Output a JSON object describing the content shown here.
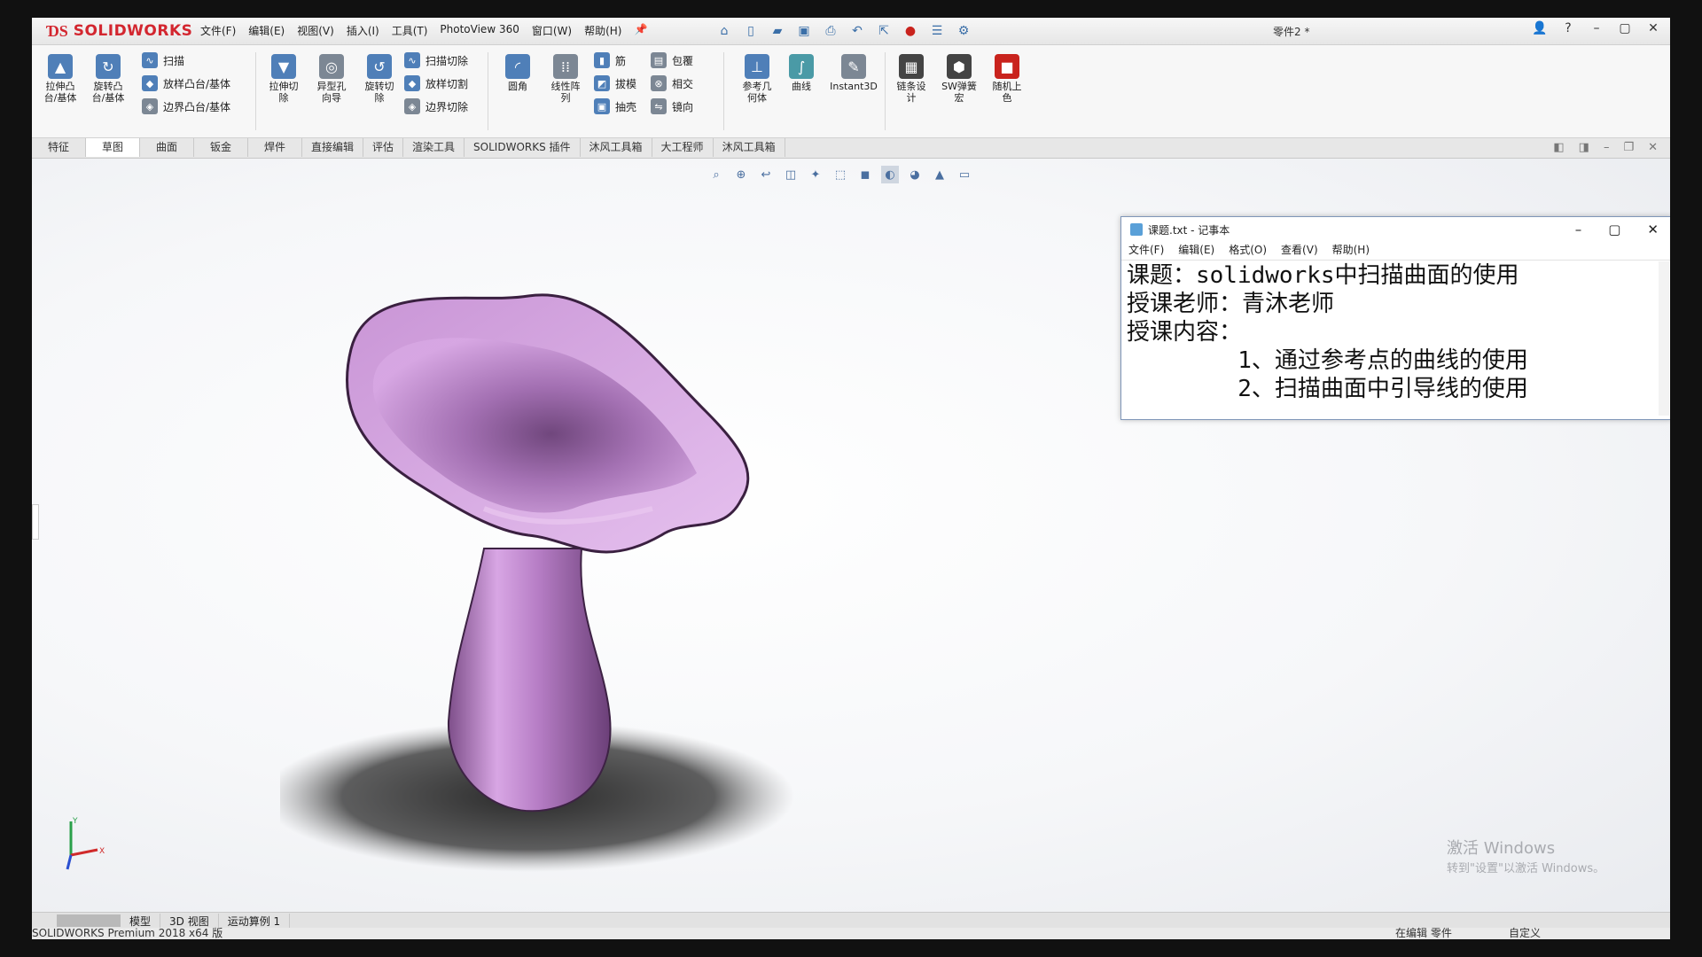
{
  "app": {
    "logo_text": "SOLIDWORKS",
    "doc_title": "零件2 *"
  },
  "menu": [
    "文件(F)",
    "编辑(E)",
    "视图(V)",
    "插入(I)",
    "工具(T)",
    "PhotoView 360",
    "窗口(W)",
    "帮助(H)"
  ],
  "ribbon": {
    "extrude_boss": "拉伸凸\n台/基体",
    "revolve_boss": "旋转凸\n台/基体",
    "sweep": "扫描",
    "loft_boss": "放样凸台/基体",
    "boundary_boss": "边界凸台/基体",
    "extrude_cut": "拉伸切\n除",
    "hole_wizard": "异型孔\n向导",
    "revolve_cut": "旋转切\n除",
    "swept_cut": "扫描切除",
    "lofted_cut": "放样切割",
    "boundary_cut": "边界切除",
    "fillet": "圆角",
    "linear_pattern": "线性阵\n列",
    "rib": "筋",
    "draft": "拔模",
    "shell": "抽壳",
    "wrap": "包覆",
    "intersect": "相交",
    "mirror": "镜向",
    "ref_geometry": "参考几\n何体",
    "curves": "曲线",
    "instant3d": "Instant3D",
    "chain_design": "链条设\n计",
    "sw_macro": "SW弹簧\n宏",
    "random_color": "随机上\n色"
  },
  "tabs": [
    "特征",
    "草图",
    "曲面",
    "钣金",
    "焊件",
    "直接编辑",
    "评估",
    "渲染工具",
    "SOLIDWORKS 插件",
    "沐风工具箱",
    "大工程师",
    "沐风工具箱"
  ],
  "active_tab": 0,
  "notepad": {
    "title": "课题.txt - 记事本",
    "menu": [
      "文件(F)",
      "编辑(E)",
      "格式(O)",
      "查看(V)",
      "帮助(H)"
    ],
    "lines": [
      "课题：solidworks中扫描曲面的使用",
      "授课老师：青沐老师",
      "授课内容：",
      "        1、通过参考点的曲线的使用",
      "        2、扫描曲面中引导线的使用"
    ]
  },
  "watermark": {
    "line1": "激活 Windows",
    "line2": "转到\"设置\"以激活 Windows。"
  },
  "bottom_tabs": [
    "模型",
    "3D 视图",
    "运动算例 1"
  ],
  "status": {
    "left": "SOLIDWORKS Premium 2018 x64 版",
    "mid": "在编辑 零件",
    "right": "自定义"
  },
  "colors": {
    "vase": "#c995d6",
    "accent": "#d3262f"
  }
}
